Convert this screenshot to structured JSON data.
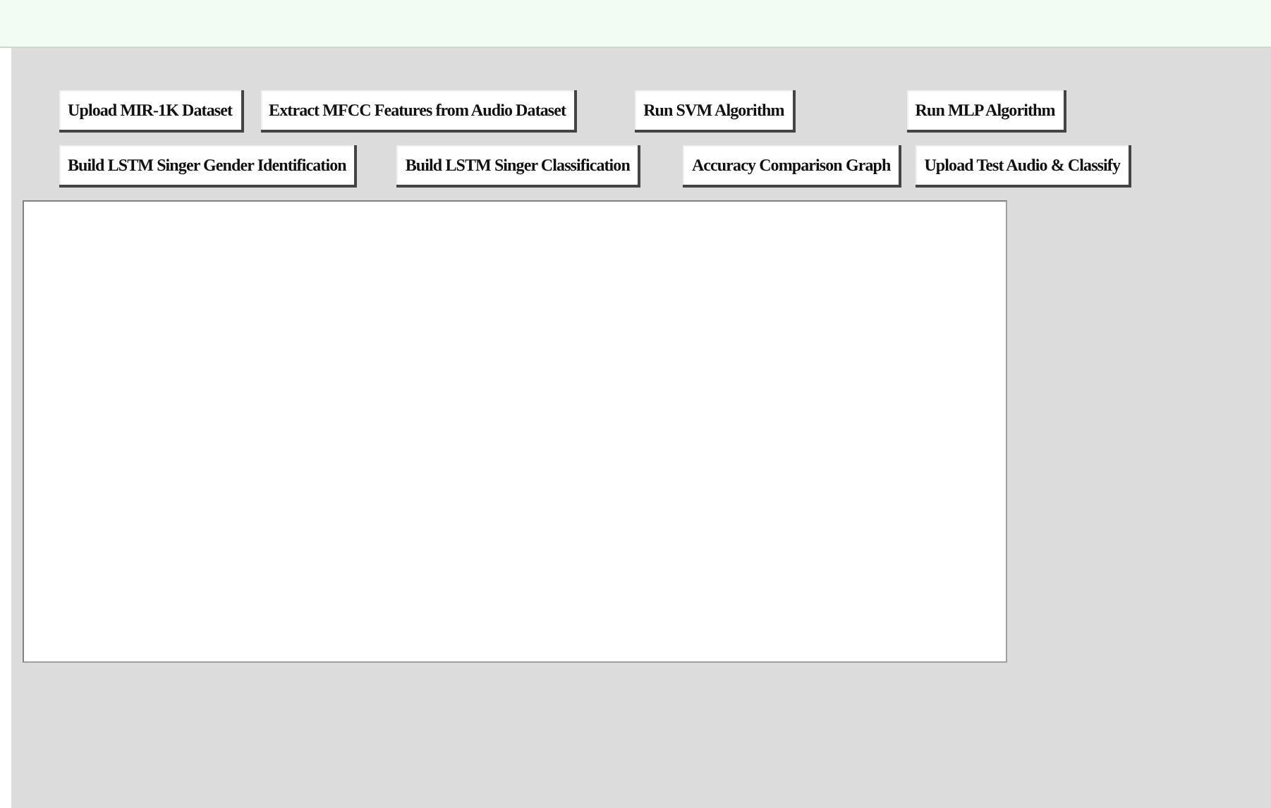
{
  "button_rows": [
    [
      "Upload MIR-1K Dataset",
      "Extract MFCC Features from Audio Dataset",
      "Run SVM Algorithm",
      "Run MLP Algorithm"
    ],
    [
      "Build LSTM Singer Gender Identification",
      "Build LSTM Singer Classification",
      "Accuracy Comparison Graph",
      "Upload Test Audio & Classify"
    ]
  ]
}
